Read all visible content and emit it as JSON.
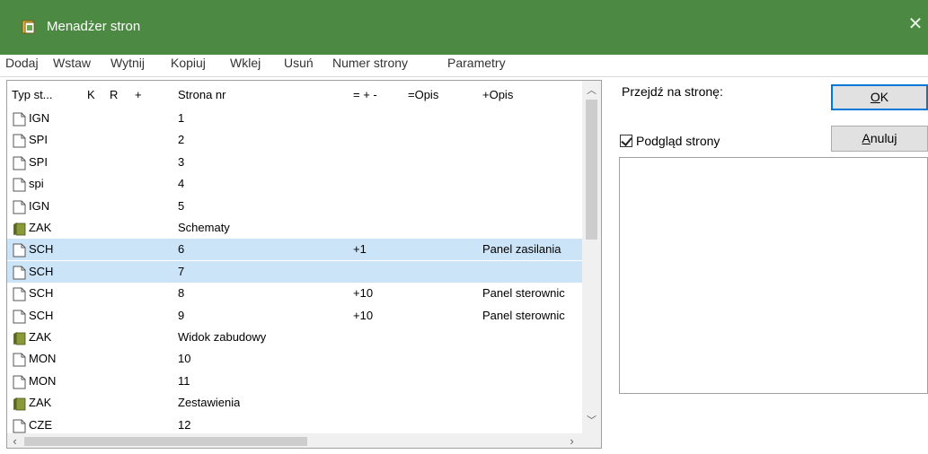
{
  "window": {
    "title": "Menadżer stron",
    "close_glyph": "✕"
  },
  "menu": [
    "Dodaj",
    "Wstaw",
    "Wytnij",
    "Kopiuj",
    "Wklej",
    "Usuń",
    "Numer strony",
    "Parametry"
  ],
  "table": {
    "columns": [
      "Typ st...",
      "K",
      "R",
      "+",
      "Strona nr",
      "= + -",
      "=Opis",
      "+Opis"
    ],
    "rows": [
      {
        "icon": "page-icon",
        "type": "IGN",
        "page": "1",
        "delta": "",
        "opis": "",
        "plus_opis": "",
        "selected": false
      },
      {
        "icon": "page-icon",
        "type": "SPI",
        "page": "2",
        "delta": "",
        "opis": "",
        "plus_opis": "",
        "selected": false
      },
      {
        "icon": "page-icon",
        "type": "SPI",
        "page": "3",
        "delta": "",
        "opis": "",
        "plus_opis": "",
        "selected": false
      },
      {
        "icon": "page-icon",
        "type": "spi",
        "page": "4",
        "delta": "",
        "opis": "",
        "plus_opis": "",
        "selected": false
      },
      {
        "icon": "page-icon",
        "type": "IGN",
        "page": "5",
        "delta": "",
        "opis": "",
        "plus_opis": "",
        "selected": false
      },
      {
        "icon": "folder-icon",
        "type": "ZAK",
        "page": "Schematy",
        "delta": "",
        "opis": "",
        "plus_opis": "",
        "selected": false
      },
      {
        "icon": "page-icon",
        "type": "SCH",
        "page": "6",
        "delta": "+1",
        "opis": "",
        "plus_opis": "Panel zasilania",
        "selected": true
      },
      {
        "icon": "page-icon",
        "type": "SCH",
        "page": "7",
        "delta": "",
        "opis": "",
        "plus_opis": "",
        "selected": true
      },
      {
        "icon": "page-icon",
        "type": "SCH",
        "page": "8",
        "delta": "+10",
        "opis": "",
        "plus_opis": "Panel sterownic",
        "selected": false
      },
      {
        "icon": "page-icon",
        "type": "SCH",
        "page": "9",
        "delta": "+10",
        "opis": "",
        "plus_opis": "Panel sterownic",
        "selected": false
      },
      {
        "icon": "folder-icon",
        "type": "ZAK",
        "page": "Widok zabudowy",
        "delta": "",
        "opis": "",
        "plus_opis": "",
        "selected": false
      },
      {
        "icon": "page-icon",
        "type": "MON",
        "page": "10",
        "delta": "",
        "opis": "",
        "plus_opis": "",
        "selected": false
      },
      {
        "icon": "page-icon",
        "type": "MON",
        "page": "11",
        "delta": "",
        "opis": "",
        "plus_opis": "",
        "selected": false
      },
      {
        "icon": "folder-icon",
        "type": "ZAK",
        "page": "Zestawienia",
        "delta": "",
        "opis": "",
        "plus_opis": "",
        "selected": false
      },
      {
        "icon": "page-icon",
        "type": "CZE",
        "page": "12",
        "delta": "",
        "opis": "",
        "plus_opis": "",
        "selected": false
      }
    ]
  },
  "goto": {
    "label": "Przejdź na stronę:",
    "value": ""
  },
  "preview": {
    "label": "Podgląd strony",
    "checked": true
  },
  "buttons": {
    "ok_label": "OK",
    "ok_mnemonic": "O",
    "ok_rest": "K",
    "cancel_mnemonic": "A",
    "cancel_rest": "nuluj"
  },
  "colors": {
    "titlebar": "#4c8a43",
    "selection": "#cce4f7",
    "folder": "#8a9a3a",
    "ok_border": "#0078d7"
  }
}
